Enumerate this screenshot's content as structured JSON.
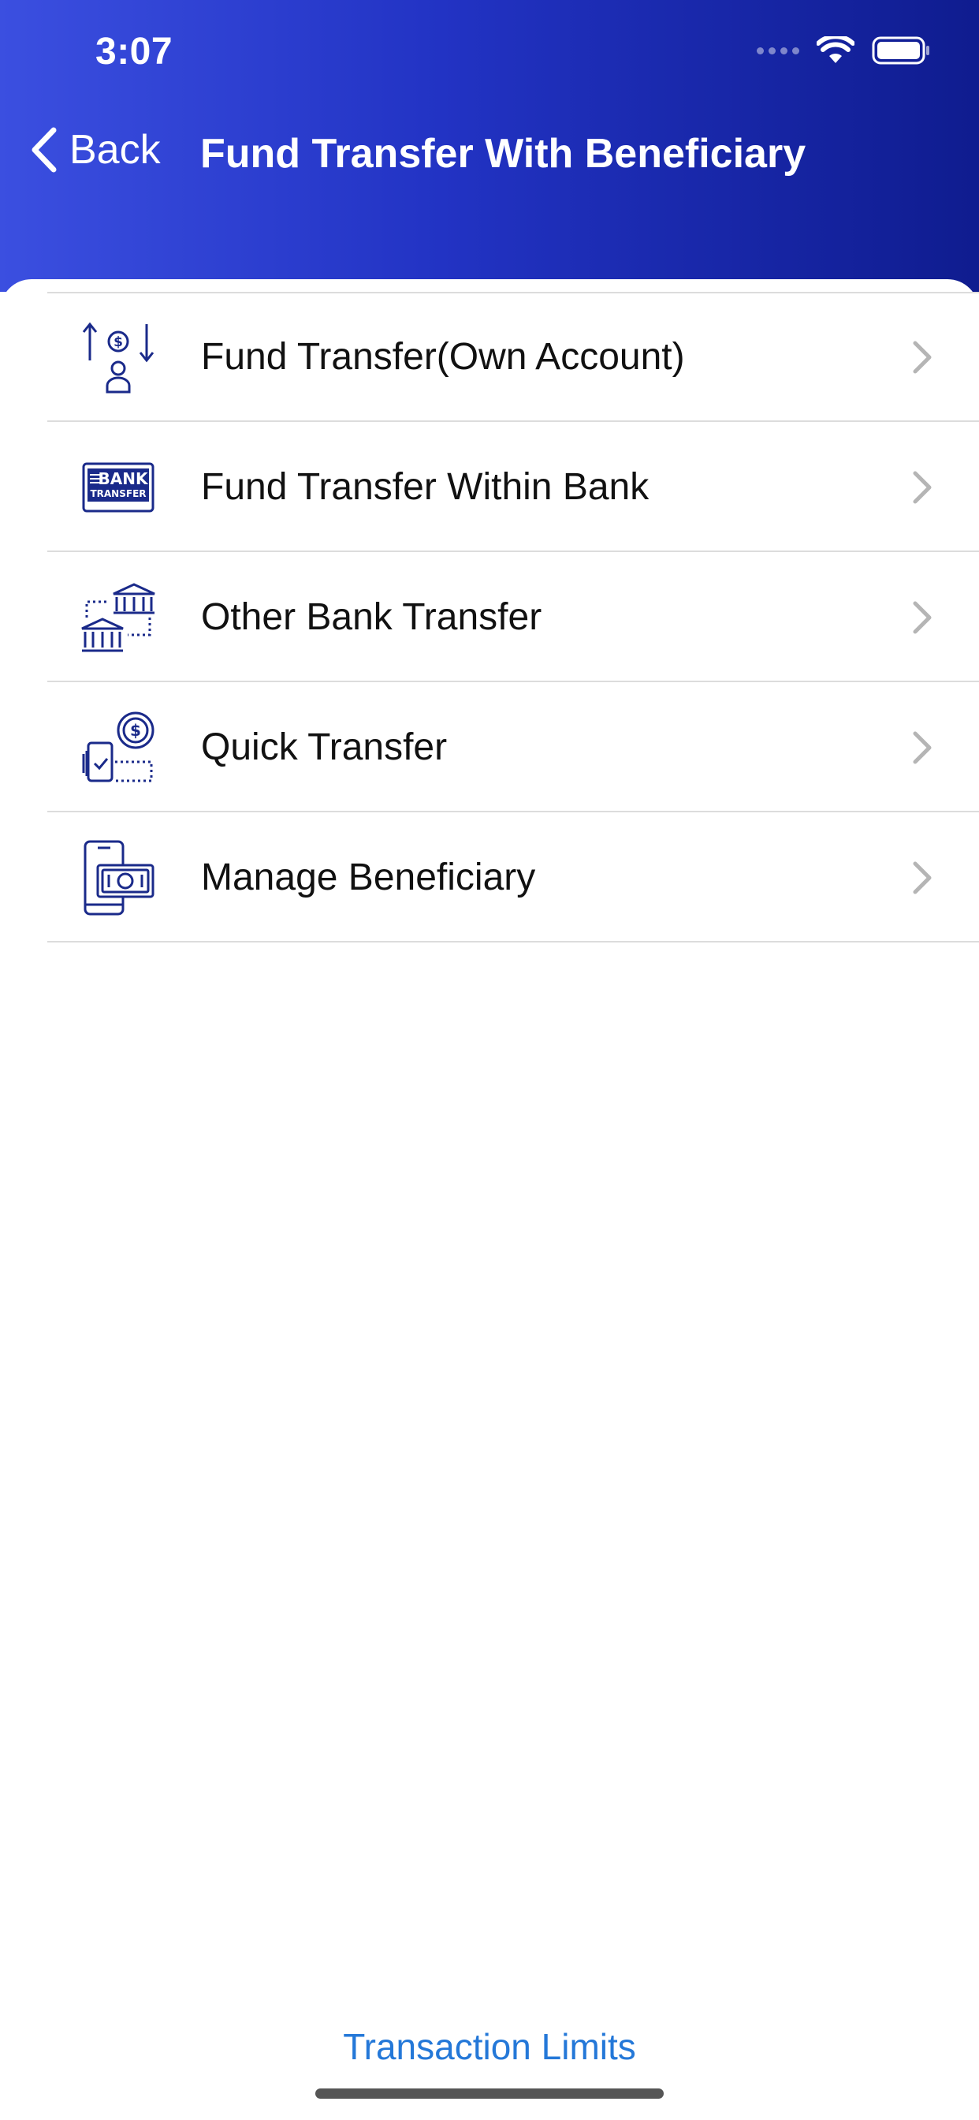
{
  "status_bar": {
    "time": "3:07"
  },
  "nav": {
    "back_label": "Back",
    "title": "Fund Transfer With Beneficiary"
  },
  "menu": {
    "items": [
      {
        "label": "Fund Transfer(Own Account)",
        "icon": "fund-transfer-own-account-icon"
      },
      {
        "label": "Fund Transfer Within Bank",
        "icon": "bank-transfer-icon"
      },
      {
        "label": "Other Bank Transfer",
        "icon": "other-bank-transfer-icon"
      },
      {
        "label": "Quick Transfer",
        "icon": "quick-transfer-icon"
      },
      {
        "label": "Manage Beneficiary",
        "icon": "manage-beneficiary-icon"
      }
    ]
  },
  "footer": {
    "link_label": "Transaction Limits"
  },
  "colors": {
    "header_start": "#3b4fe0",
    "header_end": "#0f1c8f",
    "icon_color": "#1a2a8a",
    "link_color": "#2478d8"
  }
}
